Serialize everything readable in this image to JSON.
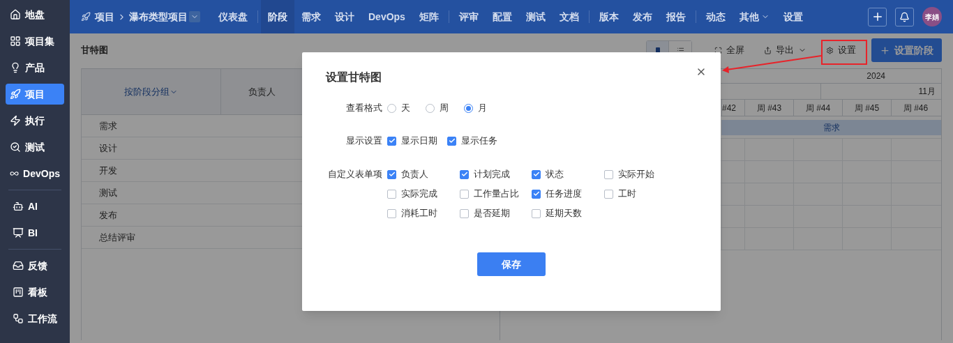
{
  "sidebar": {
    "groups": [
      [
        {
          "label": "地盘",
          "selected": false
        },
        {
          "label": "项目集",
          "selected": false
        },
        {
          "label": "产品",
          "selected": false
        },
        {
          "label": "项目",
          "selected": true
        },
        {
          "label": "执行",
          "selected": false
        },
        {
          "label": "测试",
          "selected": false
        },
        {
          "label": "DevOps",
          "selected": false
        }
      ],
      [
        {
          "label": "AI",
          "selected": false
        },
        {
          "label": "BI",
          "selected": false
        }
      ],
      [
        {
          "label": "反馈",
          "selected": false
        },
        {
          "label": "看板",
          "selected": false
        },
        {
          "label": "工作流",
          "selected": false
        }
      ]
    ]
  },
  "topbar": {
    "breadcrumb": {
      "module": "项目",
      "project": "瀑布类型项目"
    },
    "nav_groups": [
      [
        {
          "label": "仪表盘",
          "selected": false
        }
      ],
      [
        {
          "label": "阶段",
          "selected": true
        },
        {
          "label": "需求",
          "selected": false
        },
        {
          "label": "设计",
          "selected": false
        },
        {
          "label": "DevOps",
          "selected": false
        },
        {
          "label": "矩阵",
          "selected": false
        }
      ],
      [
        {
          "label": "评审",
          "selected": false
        },
        {
          "label": "配置",
          "selected": false
        },
        {
          "label": "测试",
          "selected": false
        },
        {
          "label": "文档",
          "selected": false
        }
      ],
      [
        {
          "label": "版本",
          "selected": false
        },
        {
          "label": "发布",
          "selected": false
        },
        {
          "label": "报告",
          "selected": false
        }
      ],
      [
        {
          "label": "动态",
          "selected": false
        },
        {
          "label": "其他",
          "selected": false,
          "kind": "menu"
        },
        {
          "label": "设置",
          "selected": false
        }
      ]
    ],
    "avatar": "李娟"
  },
  "gantt": {
    "title": "甘特图",
    "views": [
      {
        "kind": "gantt",
        "selected": true
      },
      {
        "kind": "list",
        "selected": false
      }
    ],
    "toolbar": [
      {
        "label": "全屏",
        "kind": "fullscreen"
      },
      {
        "label": "导出",
        "kind": "export"
      },
      {
        "label": "设置",
        "kind": "settings"
      }
    ],
    "primary_button": "设置阶段",
    "columns": [
      {
        "label": "按阶段分组",
        "kind": "menu"
      },
      {
        "label": "负责人"
      }
    ],
    "rows": [
      {
        "name": "需求",
        "bar": "需求"
      },
      {
        "name": "设计"
      },
      {
        "name": "开发"
      },
      {
        "name": "测试"
      },
      {
        "name": "发布"
      },
      {
        "name": "总结评审"
      }
    ],
    "year": "2024",
    "month": "11月",
    "weeks": [
      "#42",
      "周 #43",
      "周 #44",
      "周 #45",
      "周 #46"
    ]
  },
  "dialog": {
    "title": "设置甘特图",
    "view_format": {
      "label": "查看格式",
      "options": [
        {
          "label": "天",
          "selected": false
        },
        {
          "label": "周",
          "selected": false
        },
        {
          "label": "月",
          "selected": true
        }
      ]
    },
    "display": {
      "label": "显示设置",
      "options": [
        {
          "label": "显示日期",
          "checked": true
        },
        {
          "label": "显示任务",
          "checked": true
        }
      ]
    },
    "custom_fields": {
      "label": "自定义表单项",
      "options": [
        {
          "label": "负责人",
          "checked": true
        },
        {
          "label": "计划完成",
          "checked": true
        },
        {
          "label": "状态",
          "checked": true
        },
        {
          "label": "实际开始",
          "checked": false
        },
        {
          "label": "实际完成",
          "checked": false
        },
        {
          "label": "工作量占比",
          "checked": false
        },
        {
          "label": "任务进度",
          "checked": true
        },
        {
          "label": "工时",
          "checked": false
        },
        {
          "label": "消耗工时",
          "checked": false
        },
        {
          "label": "是否延期",
          "checked": false
        },
        {
          "label": "延期天数",
          "checked": false
        }
      ]
    },
    "save_button": "保存"
  }
}
